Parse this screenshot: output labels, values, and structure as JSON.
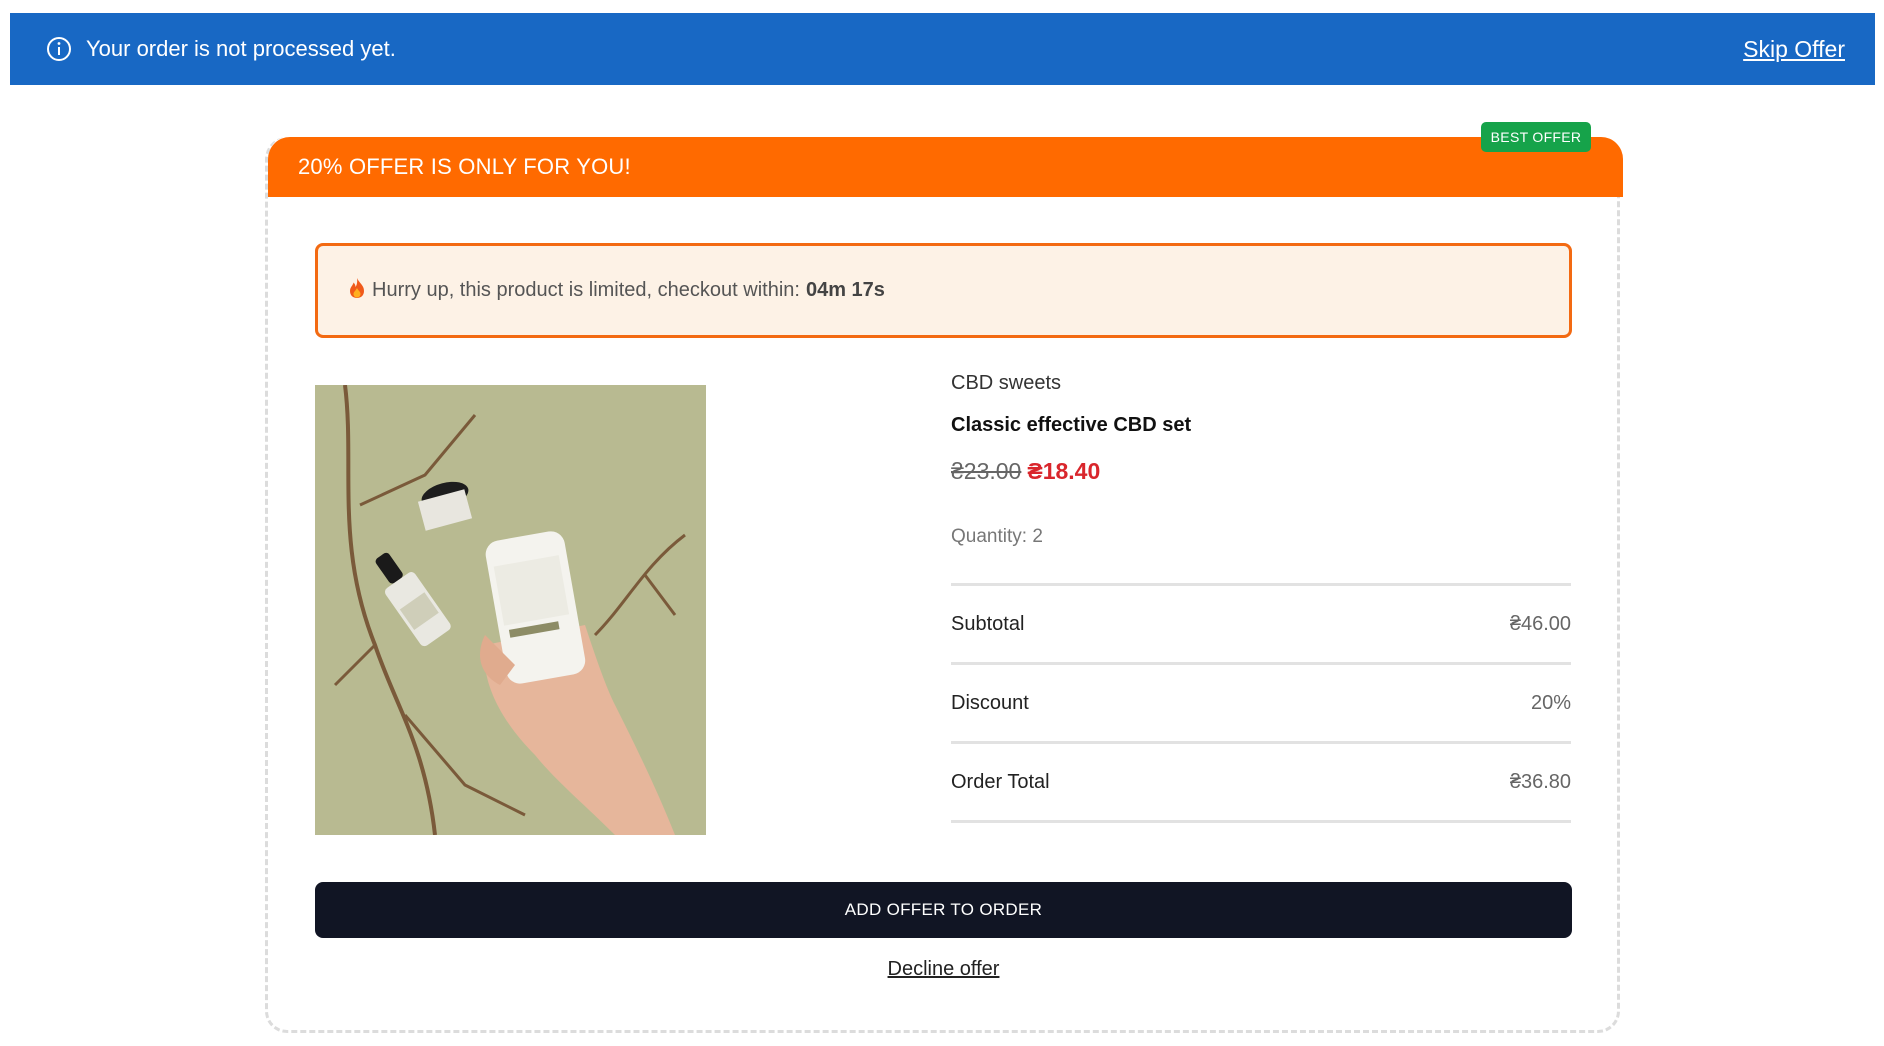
{
  "notice": {
    "icon": "info-icon",
    "text": "Your order is not processed yet.",
    "skip_label": "Skip Offer",
    "background": "#1868c4"
  },
  "offer": {
    "header": "20% OFFER IS ONLY FOR YOU!",
    "badge": "BEST OFFER",
    "header_color": "#ff6a00",
    "badge_color": "#16a34a"
  },
  "urgency": {
    "icon": "fire-icon",
    "text": "Hurry up, this product is limited, checkout within:",
    "timer": "04m 17s"
  },
  "product": {
    "category": "CBD sweets",
    "name": "Classic effective CBD set",
    "old_price": "₴23.00",
    "new_price": "₴18.40",
    "quantity_label": "Quantity: 2",
    "image_alt": "hand-holding-cbd-jar"
  },
  "summary": [
    {
      "label": "Subtotal",
      "value": "₴46.00"
    },
    {
      "label": "Discount",
      "value": "20%"
    },
    {
      "label": "Order Total",
      "value": "₴36.80"
    }
  ],
  "actions": {
    "add_label": "ADD OFFER TO ORDER",
    "decline_label": "Decline offer"
  }
}
